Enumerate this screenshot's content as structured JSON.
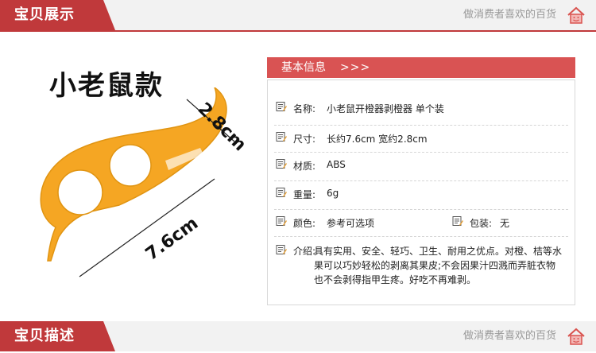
{
  "header": {
    "tab_title": "宝贝展示",
    "slogan": "做消费者喜欢的百货",
    "home_icon": "house-smiley-icon",
    "accent_color": "#c0393b"
  },
  "product": {
    "name": "小老鼠款",
    "dim_width": "2.8cm",
    "dim_length": "7.6cm",
    "color": "#f5a623"
  },
  "info": {
    "title": "基本信息",
    "arrows": ">>>",
    "rows": [
      {
        "label": "名称:",
        "value": "小老鼠开橙器剥橙器 单个装"
      },
      {
        "label": "尺寸:",
        "value": "长约7.6cm 宽约2.8cm"
      },
      {
        "label": "材质:",
        "value": "ABS"
      },
      {
        "label": "重量:",
        "value": "6g"
      }
    ],
    "color_label": "颜色:",
    "color_value": "参考可选项",
    "package_label": "包装:",
    "package_value": "无",
    "intro_label": "介绍:",
    "intro_value": "具有实用、安全、轻巧、卫生、耐用之优点。对橙、桔等水果可以巧妙轻松的剥离其果皮;不会因果汁四溅而弄脏衣物也不会剥得指甲生疼。好吃不再难剥。"
  },
  "footer": {
    "tab_title": "宝贝描述",
    "slogan": "做消费者喜欢的百货"
  }
}
